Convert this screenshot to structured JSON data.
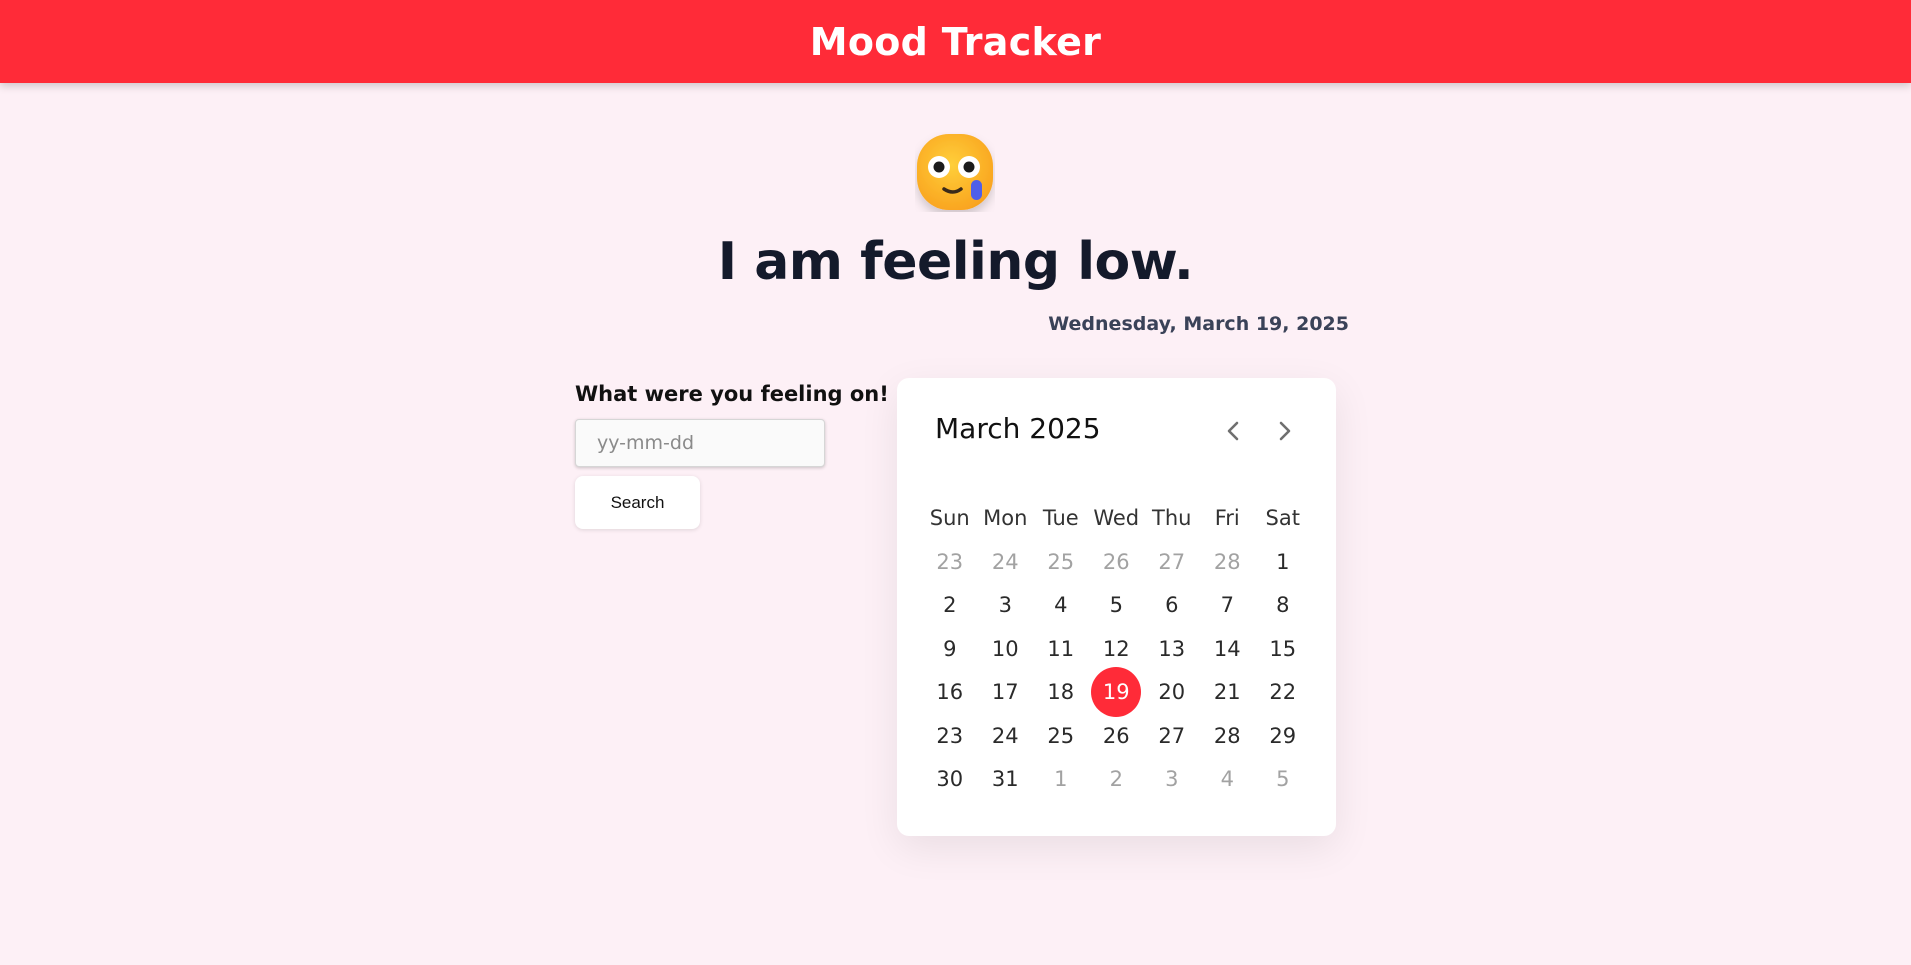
{
  "header": {
    "title": "Mood Tracker"
  },
  "mood": {
    "emoji_icon": "face-holding-back-tears-icon",
    "heading": "I am feeling low.",
    "date": "Wednesday, March 19, 2025"
  },
  "search": {
    "label": "What were you feeling on!",
    "placeholder": "yy-mm-dd",
    "button_label": "Search"
  },
  "calendar": {
    "month_title": "March 2025",
    "prev_icon": "chevron-left-icon",
    "next_icon": "chevron-right-icon",
    "weekdays": [
      "Sun",
      "Mon",
      "Tue",
      "Wed",
      "Thu",
      "Fri",
      "Sat"
    ],
    "weeks": [
      [
        "23",
        "24",
        "25",
        "26",
        "27",
        "28",
        "1"
      ],
      [
        "2",
        "3",
        "4",
        "5",
        "6",
        "7",
        "8"
      ],
      [
        "9",
        "10",
        "11",
        "12",
        "13",
        "14",
        "15"
      ],
      [
        "16",
        "17",
        "18",
        "19",
        "20",
        "21",
        "22"
      ],
      [
        "23",
        "24",
        "25",
        "26",
        "27",
        "28",
        "29"
      ],
      [
        "30",
        "31",
        "1",
        "2",
        "3",
        "4",
        "5"
      ]
    ],
    "selected_day": "19",
    "accent_color": "#ff2b38"
  },
  "colors": {
    "header_bg": "#ff2b38",
    "page_bg": "#fdf0f6",
    "muted_day": "#a2a2a2"
  }
}
